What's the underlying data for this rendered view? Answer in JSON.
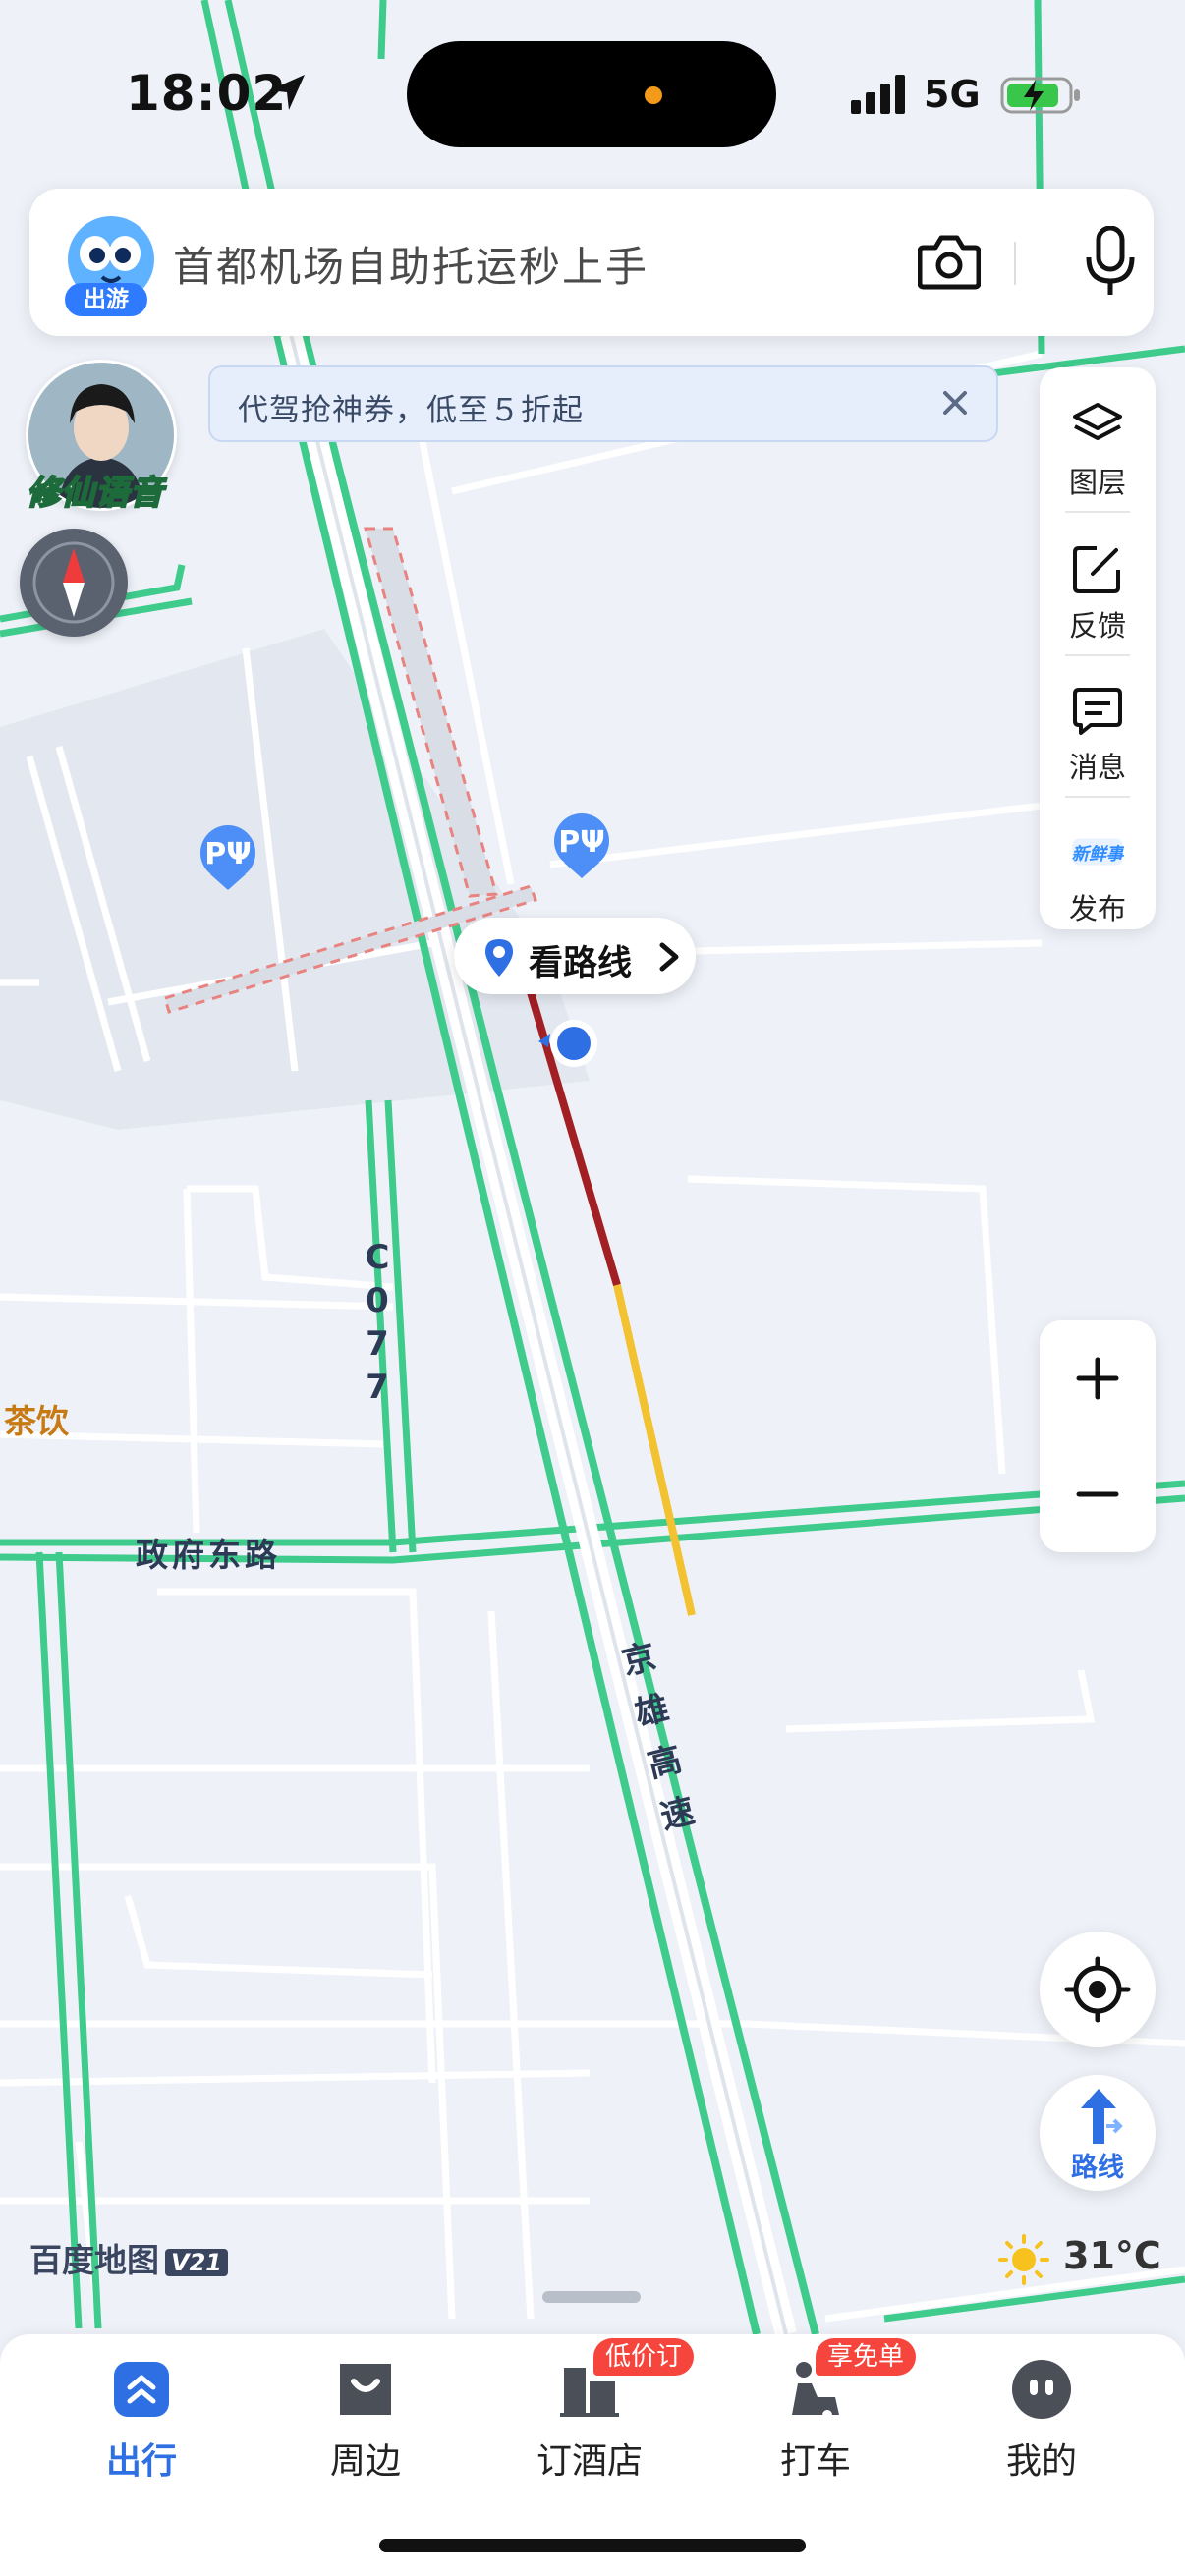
{
  "status_bar": {
    "time": "18:02",
    "network": "5G"
  },
  "search": {
    "mascot_tag": "出游",
    "placeholder": "首都机场自助托运秒上手",
    "camera_icon": "camera-icon",
    "mic_icon": "microphone-icon"
  },
  "voice_pack": {
    "label": "修仙语音"
  },
  "promo": {
    "text": "代驾抢神券，低至５折起"
  },
  "tools": [
    {
      "label": "图层",
      "icon": "layers-icon"
    },
    {
      "label": "反馈",
      "icon": "feedback-icon"
    },
    {
      "label": "消息",
      "icon": "message-icon"
    },
    {
      "label": "发布",
      "icon": "publish-icon",
      "badge_art": "新鲜事"
    }
  ],
  "callout": {
    "label": "看路线"
  },
  "map_labels": {
    "road_c077": [
      "C",
      "0",
      "7",
      "7"
    ],
    "zhengfu_road": "政府东路",
    "jingxiong": [
      "京",
      "雄",
      "高",
      "速"
    ],
    "tea_poi": "茶饮"
  },
  "branding": {
    "logo": "百度地图",
    "version": "V21"
  },
  "weather": {
    "temperature": "31°C",
    "icon": "sun-icon"
  },
  "route_button": {
    "label": "路线"
  },
  "bottom_nav": [
    {
      "label": "出行",
      "active": true,
      "icon": "travel-icon"
    },
    {
      "label": "周边",
      "active": false,
      "icon": "nearby-icon"
    },
    {
      "label": "订酒店",
      "active": false,
      "icon": "hotel-icon",
      "badge": "低价订"
    },
    {
      "label": "打车",
      "active": false,
      "icon": "taxi-icon",
      "badge": "享免单"
    },
    {
      "label": "我的",
      "active": false,
      "icon": "profile-icon"
    }
  ],
  "colors": {
    "accent": "#2f6fe4",
    "road_green": "#3ecb8c",
    "traffic_red": "#a21f23",
    "traffic_yellow": "#f2c230",
    "badge_red": "#f5453d"
  }
}
